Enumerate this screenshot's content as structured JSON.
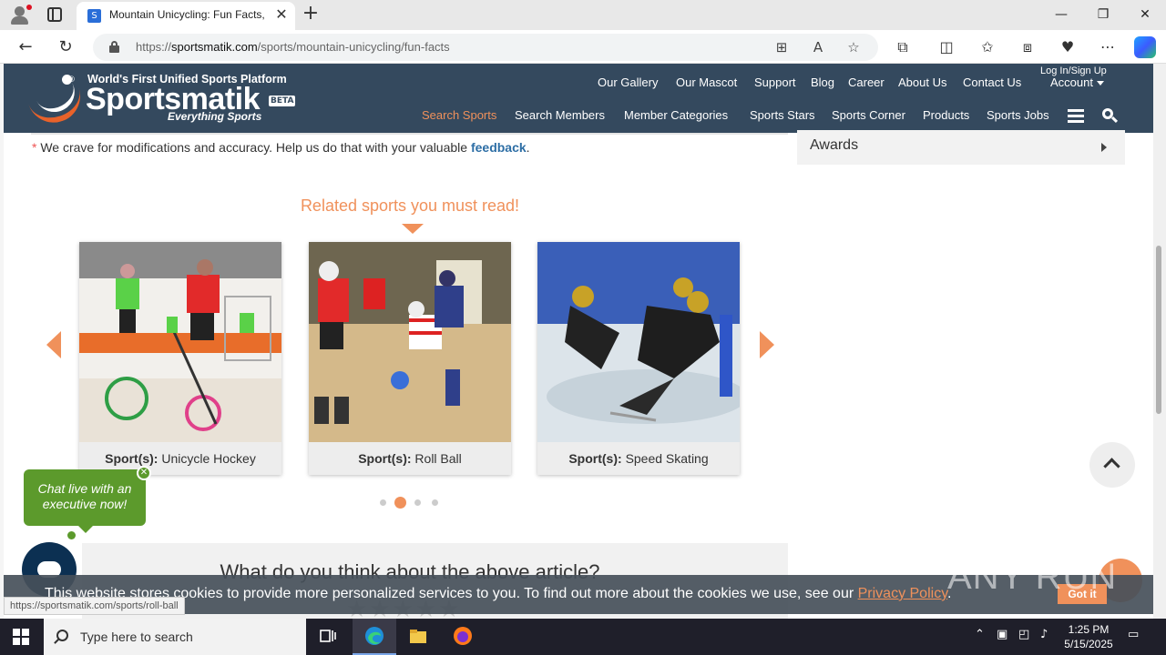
{
  "browser": {
    "tab_title": "Mountain Unicycling: Fun Facts,",
    "url_scheme": "https://",
    "url_domain": "sportsmatik.com",
    "url_path": "/sports/mountain-unicycling/fun-facts",
    "status_url": "https://sportsmatik.com/sports/roll-ball"
  },
  "header": {
    "tagline": "World's First Unified Sports Platform",
    "brand": "Sportsmatik",
    "beta": "BETA",
    "subtitle": "Everything Sports",
    "top_nav": [
      "Our Gallery",
      "Our Mascot",
      "Support",
      "Blog",
      "Career",
      "About Us",
      "Contact Us"
    ],
    "login": "Log In/Sign Up",
    "account": "Account",
    "main_nav": [
      "Search Sports",
      "Search Members",
      "Member Categories",
      "Sports Stars",
      "Sports Corner",
      "Products",
      "Sports Jobs"
    ]
  },
  "feedback": {
    "text": "We crave for modifications and accuracy. Help us do that with your valuable ",
    "link": "feedback",
    "end": "."
  },
  "sidebar": {
    "awards": "Awards"
  },
  "related": {
    "title": "Related sports you must read!",
    "prefix": "Sport(s):",
    "cards": [
      {
        "sport": "Unicycle Hockey"
      },
      {
        "sport": "Roll Ball"
      },
      {
        "sport": "Speed Skating"
      }
    ],
    "pages": 4,
    "active_page": 2
  },
  "chat": {
    "message": "Chat live with an executive now!"
  },
  "rating": {
    "question": "What do you think about the above article?"
  },
  "cookie": {
    "text": "This website stores cookies to provide more personalized services to you. To find out more about the cookies we use, see our ",
    "link": "Privacy Policy",
    "end": ".",
    "button": "Got it"
  },
  "watermark": "ANY RUN",
  "taskbar": {
    "search_placeholder": "Type here to search",
    "time": "1:25 PM",
    "date": "5/15/2025"
  },
  "colors": {
    "header_bg": "#34495e",
    "accent": "#f0915b",
    "link": "#2d6ea5",
    "chat_green": "#5c9a2c"
  }
}
